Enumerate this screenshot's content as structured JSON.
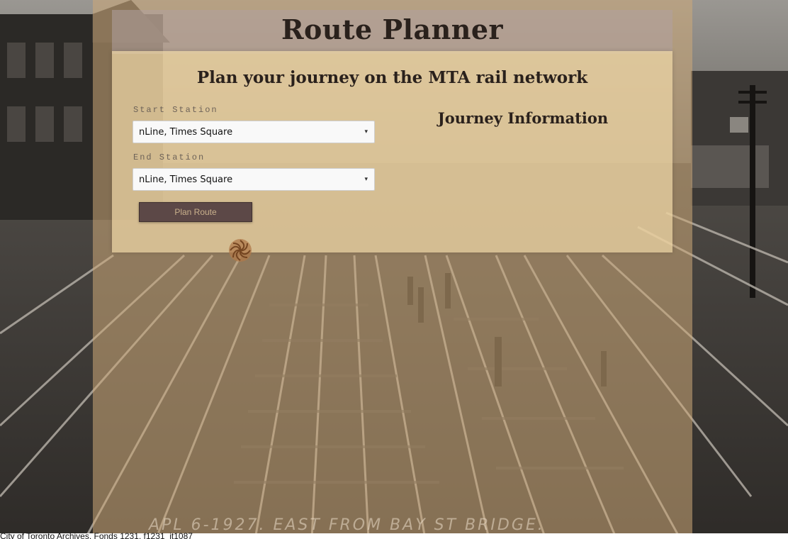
{
  "header": {
    "title": "Route Planner"
  },
  "planner": {
    "subtitle": "Plan your journey on the MTA rail network",
    "start_label": "Start Station",
    "start_value": "nLine, Times Square",
    "end_label": "End Station",
    "end_value": "nLine, Times Square",
    "plan_button_label": "Plan Route"
  },
  "journey": {
    "heading": "Journey Information"
  },
  "background": {
    "photo_caption": "APL 6-1927. EAST FROM BAY ST BRIDGE.",
    "credit": "City of Toronto Archives, Fonds 1231, f1231_it1087"
  },
  "icons": {
    "select_arrow": "chevron-down-icon",
    "spinner": "loading-spinner-icon"
  },
  "colors": {
    "button_bg": "#5c4847",
    "button_text": "#c9b08c",
    "panel_bg": "#eed7a6",
    "title_text": "#2a211c"
  }
}
